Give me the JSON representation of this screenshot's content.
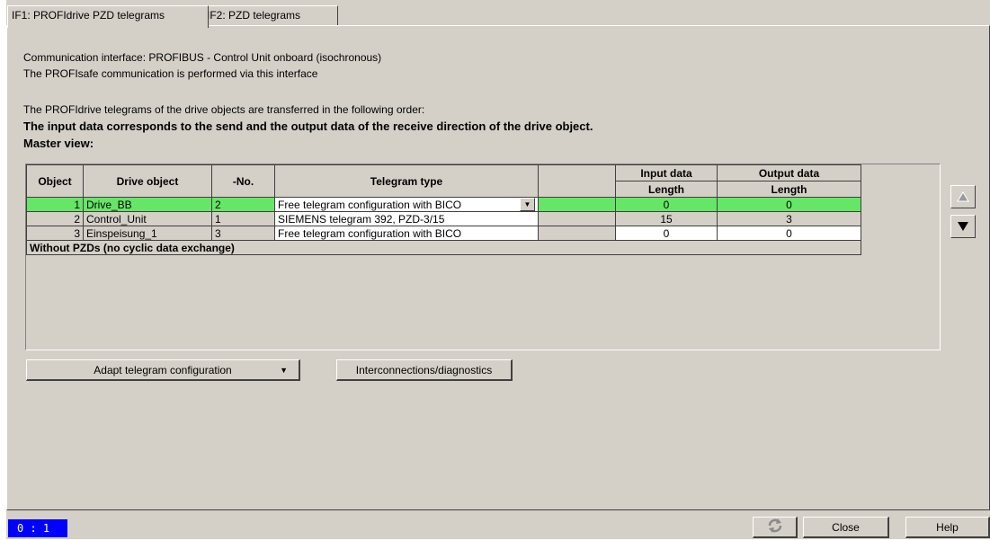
{
  "tabs": [
    "IF1: PROFIdrive PZD telegrams",
    "IF2: PZD telegrams"
  ],
  "info": {
    "line1": "Communication interface: PROFIBUS - Control Unit onboard (isochronous)",
    "line2": "The PROFIsafe communication is performed via this interface",
    "line3": "The PROFIdrive telegrams of the drive objects are transferred in the following order:",
    "line4": "The input data corresponds to the send and the output data of the receive direction of the drive object.",
    "line5": "Master view:"
  },
  "table": {
    "headers": {
      "object": "Object",
      "drive_object": "Drive object",
      "no": "-No.",
      "telegram_type": "Telegram type",
      "input_data": "Input data",
      "output_data": "Output data",
      "length_in": "Length",
      "length_out": "Length"
    },
    "rows": [
      {
        "object": "1",
        "drive_object": "Drive_BB",
        "no": "2",
        "telegram": "Free telegram configuration with BICO",
        "input": "0",
        "output": "0"
      },
      {
        "object": "2",
        "drive_object": "Control_Unit",
        "no": "1",
        "telegram": "SIEMENS telegram 392, PZD-3/15",
        "input": "15",
        "output": "3"
      },
      {
        "object": "3",
        "drive_object": "Einspeisung_1",
        "no": "3",
        "telegram": "Free telegram configuration with BICO",
        "input": "0",
        "output": "0"
      }
    ],
    "footer": "Without PZDs (no cyclic data exchange)"
  },
  "buttons": {
    "adapt": "Adapt telegram configuration",
    "interconnections": "Interconnections/diagnostics",
    "close": "Close",
    "help": "Help"
  },
  "status": "0 : 1",
  "colors": {
    "selected_row": "#66e666",
    "status_bg": "#0000ff",
    "window_bg": "#d4d0c8"
  }
}
